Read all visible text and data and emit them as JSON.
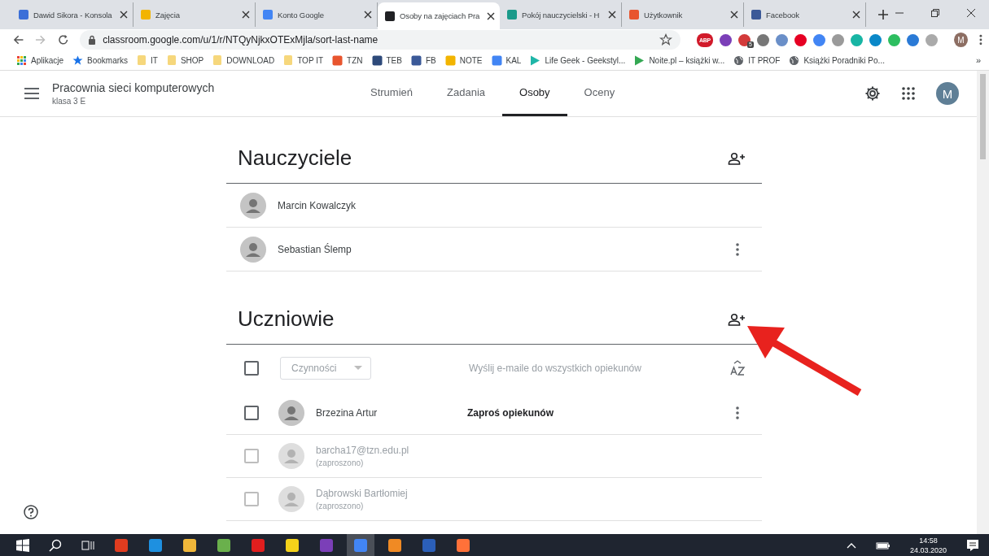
{
  "browser": {
    "tabs": [
      {
        "title": "Dawid Sikora - Konsola",
        "selected": false,
        "color": "#3b6fd8"
      },
      {
        "title": "Zajęcia",
        "selected": false,
        "color": "#f2b400"
      },
      {
        "title": "Konto Google",
        "selected": false,
        "color": "#4285f4"
      },
      {
        "title": "Osoby na zajęciach Pra",
        "selected": true,
        "color": "#202124"
      },
      {
        "title": "Pokój nauczycielski - H",
        "selected": false,
        "color": "#1a9a8a"
      },
      {
        "title": "Użytkownik",
        "selected": false,
        "color": "#e8552e"
      },
      {
        "title": "Facebook",
        "selected": false,
        "color": "#3b5998"
      }
    ],
    "url": "classroom.google.com/u/1/r/NTQyNjkxOTExMjla/sort-last-name",
    "extensions": [
      {
        "color": "#d11a2a",
        "label": "ABP"
      },
      {
        "color": "#7b3fb8"
      },
      {
        "color": "#d33a3a",
        "badge": "5"
      },
      {
        "color": "#777777"
      },
      {
        "color": "#6a8fc8"
      },
      {
        "color": "#e60023"
      },
      {
        "color": "#4285f4"
      },
      {
        "color": "#9a9a9a"
      },
      {
        "color": "#18b5a4"
      },
      {
        "color": "#0a88c8"
      },
      {
        "color": "#2dbe60"
      },
      {
        "color": "#2a7ad6"
      },
      {
        "color": "#aaaaaa"
      }
    ],
    "profile_initial": "M",
    "bookmarks": [
      {
        "kind": "apps",
        "label": "Aplikacje"
      },
      {
        "kind": "star",
        "label": "Bookmarks"
      },
      {
        "kind": "folder",
        "label": "IT"
      },
      {
        "kind": "folder",
        "label": "SHOP"
      },
      {
        "kind": "folder",
        "label": "DOWNLOAD"
      },
      {
        "kind": "folder",
        "label": "TOP IT"
      },
      {
        "kind": "site",
        "label": "TZN",
        "color": "#e8552e"
      },
      {
        "kind": "site",
        "label": "TEB",
        "color": "#2e4a7a"
      },
      {
        "kind": "site",
        "label": "FB",
        "color": "#3b5998"
      },
      {
        "kind": "site",
        "label": "NOTE",
        "color": "#f2b400"
      },
      {
        "kind": "site",
        "label": "KAL",
        "color": "#4285f4"
      },
      {
        "kind": "play",
        "label": "Life Geek - Geekstyl...",
        "color": "#1fb6a8"
      },
      {
        "kind": "play",
        "label": "Noite.pl – książki w...",
        "color": "#34a853"
      },
      {
        "kind": "globe",
        "label": "IT PROF"
      },
      {
        "kind": "globe",
        "label": "Książki Poradniki Po..."
      }
    ],
    "more": "»"
  },
  "app": {
    "title": "Pracownia sieci komputerowych",
    "subtitle": "klasa 3 E",
    "nav": [
      {
        "label": "Strumień",
        "selected": false
      },
      {
        "label": "Zadania",
        "selected": false
      },
      {
        "label": "Osoby",
        "selected": true
      },
      {
        "label": "Oceny",
        "selected": false
      }
    ],
    "avatar": "M"
  },
  "teachers": {
    "heading": "Nauczyciele",
    "people": [
      {
        "name": "Marcin Kowalczyk",
        "has_menu": false
      },
      {
        "name": "Sebastian Ślemp",
        "has_menu": true
      }
    ]
  },
  "students": {
    "heading": "Uczniowie",
    "select_all_checked": false,
    "actions": "Czynności",
    "email_all": "Wyślij e-maile do wszystkich opiekunów",
    "rows": [
      {
        "name": "Brzezina Artur",
        "invited": false,
        "checked": false,
        "link": "Zaproś opiekunów",
        "has_menu": true
      },
      {
        "name": "barcha17@tzn.edu.pl",
        "status": "(zaproszono)",
        "invited": true,
        "checked": false,
        "has_menu": false
      },
      {
        "name": "Dąbrowski Bartłomiej",
        "status": "(zaproszono)",
        "invited": true,
        "checked": false,
        "has_menu": false
      }
    ]
  },
  "taskbar": {
    "apps": [
      {
        "color": "#e03c1f",
        "active": false
      },
      {
        "color": "#1e90e0",
        "active": false
      },
      {
        "color": "#f0b73a",
        "active": false
      },
      {
        "color": "#6ab04c",
        "active": false
      },
      {
        "color": "#e01e1e",
        "active": false
      },
      {
        "color": "#f4d21a",
        "active": false
      },
      {
        "color": "#7b3fb8",
        "active": false
      },
      {
        "color": "#4285f4",
        "active": true
      },
      {
        "color": "#f08a24",
        "active": false
      },
      {
        "color": "#2b5fb8",
        "active": false
      },
      {
        "color": "#ff7139",
        "active": false
      }
    ],
    "time": "14:58",
    "date": "24.03.2020"
  }
}
